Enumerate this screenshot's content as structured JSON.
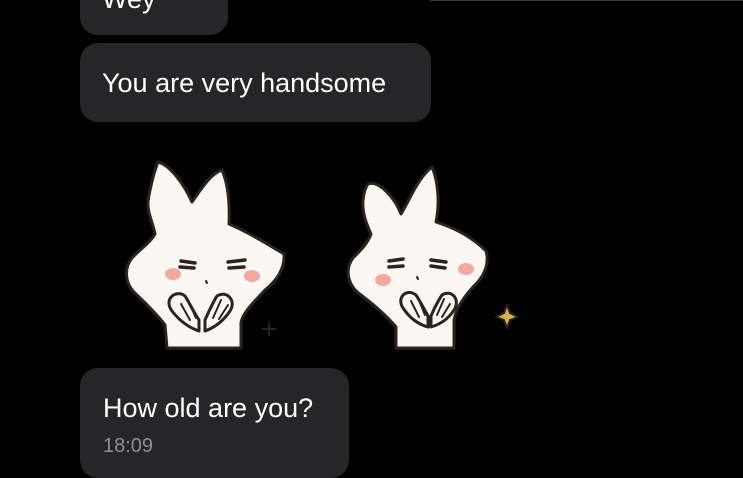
{
  "messages": {
    "previous_fragment": "Wey",
    "compliment": "You are very handsome",
    "question": "How old are you?",
    "question_time": "18:09"
  },
  "stickers": [
    {
      "name": "white fox sticker",
      "icon": "fox-shy-sticker"
    },
    {
      "name": "white fox sticker mirrored",
      "icon": "fox-shy-sticker"
    }
  ],
  "colors": {
    "background": "#000000",
    "bubble": "#262628",
    "text": "#ffffff",
    "timestamp": "#8e8e93",
    "sticker_fill": "#fbf8f3",
    "sticker_outline": "#2b2320",
    "blush": "#f6a7a0",
    "sparkle": "#d6b24a"
  }
}
